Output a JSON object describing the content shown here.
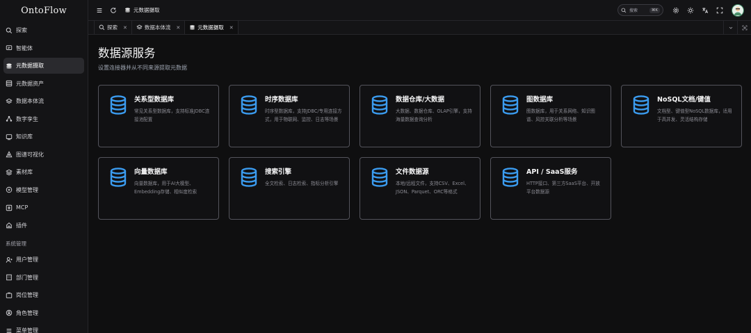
{
  "brand": "OntoFlow",
  "sidebar": {
    "items": [
      {
        "label": "探索",
        "icon": "search-icon"
      },
      {
        "label": "智能体",
        "icon": "chat-icon"
      },
      {
        "label": "元数据摄取",
        "icon": "layers-icon",
        "active": true
      },
      {
        "label": "元数据资产",
        "icon": "database-icon"
      },
      {
        "label": "数据本体流",
        "icon": "stack-icon"
      },
      {
        "label": "数字孪生",
        "icon": "network-icon"
      },
      {
        "label": "知识库",
        "icon": "book-icon"
      },
      {
        "label": "图谱可视化",
        "icon": "graph-icon"
      },
      {
        "label": "素材库",
        "icon": "package-icon"
      },
      {
        "label": "模型管理",
        "icon": "model-icon"
      },
      {
        "label": "MCP",
        "icon": "mcp-icon"
      },
      {
        "label": "插件",
        "icon": "plugin-icon"
      }
    ],
    "section_label": "系统管理",
    "system_items": [
      {
        "label": "用户管理",
        "icon": "user-icon"
      },
      {
        "label": "部门管理",
        "icon": "building-icon"
      },
      {
        "label": "岗位管理",
        "icon": "badge-icon"
      },
      {
        "label": "角色管理",
        "icon": "role-icon"
      },
      {
        "label": "菜单管理",
        "icon": "menu-icon"
      }
    ]
  },
  "topbar": {
    "breadcrumb": "元数据摄取",
    "search_label": "搜索",
    "search_shortcut": "⌘K"
  },
  "tabs": [
    {
      "label": "探索",
      "icon": "search-icon"
    },
    {
      "label": "数据本体流",
      "icon": "stack-icon"
    },
    {
      "label": "元数据摄取",
      "icon": "layers-icon",
      "active": true
    }
  ],
  "page": {
    "title": "数据源服务",
    "subtitle": "设置连接器并从不同来源提取元数据"
  },
  "cards": [
    {
      "title": "关系型数据库",
      "desc": "常见关系型数据库，支持标准JDBC连接池配置"
    },
    {
      "title": "时序数据库",
      "desc": "时序型数据库，支持JDBC/专用连接方式，用于物联网、监控、日志等场景"
    },
    {
      "title": "数据仓库/大数据",
      "desc": "大数据、数据仓库、OLAP引擎，支持海量数据查询分析"
    },
    {
      "title": "图数据库",
      "desc": "图数据库，用于关系网络、知识图谱、风控关联分析等场景"
    },
    {
      "title": "NoSQL文档/键值",
      "desc": "文档型、键值型NoSQL数据库，适用于高并发、灵活结构存储"
    },
    {
      "title": "向量数据库",
      "desc": "向量数据库，用于AI大模型、Embedding存储、相似度检索"
    },
    {
      "title": "搜索引擎",
      "desc": "全文检索、日志检索、指标分析引擎"
    },
    {
      "title": "文件数据源",
      "desc": "本地/远程文件，支持CSV、Excel、JSON、Parquet、ORC等格式"
    },
    {
      "title": "API / SaaS服务",
      "desc": "HTTP接口、第三方SaaS平台、开放平台数据源"
    }
  ],
  "colors": {
    "accent": "#3b9cf0",
    "background": "#0f0f10",
    "card_border": "#54545c"
  }
}
